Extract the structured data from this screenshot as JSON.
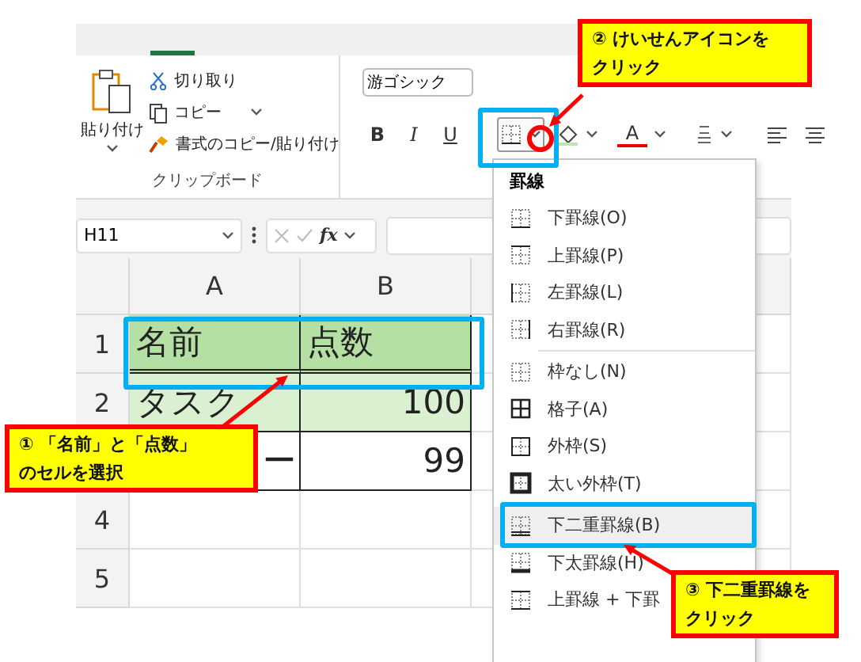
{
  "ribbon": {
    "clipboard": {
      "paste": "貼り付け",
      "cut": "切り取り",
      "copy": "コピー",
      "format_painter": "書式のコピー/貼り付け",
      "group_label": "クリップボード"
    },
    "font": {
      "font_name": "游ゴシック",
      "bold": "B",
      "italic": "I",
      "underline": "U",
      "font_color": "A"
    }
  },
  "formula_bar": {
    "name_box": "H11",
    "fx": "fx"
  },
  "sheet": {
    "columns": [
      "A",
      "B"
    ],
    "rows": [
      {
        "header": "1",
        "color": "#b4e0a4",
        "double_bottom": true,
        "cells": [
          {
            "text": "名前",
            "kind": "text"
          },
          {
            "text": "点数",
            "kind": "text"
          }
        ]
      },
      {
        "header": "2",
        "color": "#d9f1d1",
        "double_bottom": false,
        "cells": [
          {
            "text": "タスク",
            "kind": "text"
          },
          {
            "text": "100",
            "kind": "number"
          }
        ]
      },
      {
        "color": "#ffffff",
        "double_bottom": false,
        "cells": [
          {
            "text": "ー",
            "kind": "partial"
          },
          {
            "text": "99",
            "kind": "number"
          }
        ]
      },
      {
        "header": "4",
        "color": "#ffffff",
        "double_bottom": false,
        "cells": []
      },
      {
        "header": "5",
        "color": "#ffffff",
        "double_bottom": false,
        "cells": []
      }
    ]
  },
  "border_menu": {
    "title": "罫線",
    "items": [
      {
        "label": "下罫線(O)",
        "kind": "bottom",
        "selected": false,
        "divider_before": false
      },
      {
        "label": "上罫線(P)",
        "kind": "top",
        "selected": false,
        "divider_before": false
      },
      {
        "label": "左罫線(L)",
        "kind": "left",
        "selected": false,
        "divider_before": false
      },
      {
        "label": "右罫線(R)",
        "kind": "right",
        "selected": false,
        "divider_before": false
      },
      {
        "label": "枠なし(N)",
        "kind": "none",
        "selected": false,
        "divider_before": true
      },
      {
        "label": "格子(A)",
        "kind": "all",
        "selected": false,
        "divider_before": false
      },
      {
        "label": "外枠(S)",
        "kind": "outside",
        "selected": false,
        "divider_before": false
      },
      {
        "label": "太い外枠(T)",
        "kind": "thick",
        "selected": false,
        "divider_before": false
      },
      {
        "label": "下二重罫線(B)",
        "kind": "double",
        "selected": true,
        "divider_before": true
      },
      {
        "label": "下太罫線(H)",
        "kind": "heavy",
        "selected": false,
        "divider_before": false
      },
      {
        "label": "上罫線 + 下罫",
        "kind": "pair",
        "selected": false,
        "divider_before": false
      }
    ]
  },
  "callouts": [
    {
      "step": "①",
      "lines": [
        "「名前」と「点数」",
        "のセルを選択"
      ]
    },
    {
      "step": "②",
      "lines": [
        "けいせんアイコンを",
        "クリック"
      ]
    },
    {
      "step": "③",
      "lines": [
        "下二重罫線を",
        "クリック"
      ]
    }
  ]
}
